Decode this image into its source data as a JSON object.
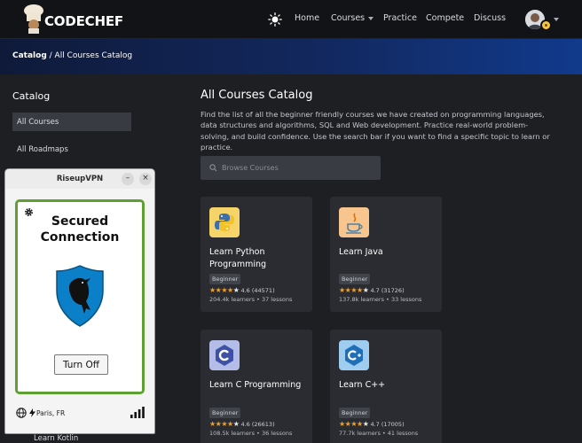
{
  "brand": {
    "name": "CODECHEF"
  },
  "nav": {
    "home": "Home",
    "courses": "Courses",
    "practice": "Practice",
    "compete": "Compete",
    "discuss": "Discuss"
  },
  "breadcrumb": {
    "root": "Catalog",
    "separator": " / ",
    "current": "All Courses Catalog"
  },
  "sidebar": {
    "heading": "Catalog",
    "items": [
      {
        "label": "All Courses",
        "active": true
      },
      {
        "label": "All Roadmaps",
        "active": false
      },
      {
        "label": "Learn Kotlin",
        "active": false
      }
    ]
  },
  "main": {
    "title": "All Courses Catalog",
    "description": "Find the list of all the beginner friendly courses we have created on programming languages, data structures and algorithms, SQL and Web development. Practice real-world problem-solving, and build confidence. Use the search bar if you want to find a specific topic to learn or practice.",
    "search_placeholder": "Browse Courses"
  },
  "courses": [
    {
      "title": "Learn Python Programming",
      "level": "Beginner",
      "rating": "4.6",
      "reviews": "(44571)",
      "stars": 4.6,
      "learners": "204.4k learners",
      "lessons": "37 lessons",
      "icon": "python-icon",
      "icon_bg": "#f5d46a"
    },
    {
      "title": "Learn Java",
      "level": "Beginner",
      "rating": "4.7",
      "reviews": "(31726)",
      "stars": 4.7,
      "learners": "137.8k learners",
      "lessons": "33 lessons",
      "icon": "java-icon",
      "icon_bg": "#f7c58d"
    },
    {
      "title": "Learn C Programming",
      "level": "Beginner",
      "rating": "4.6",
      "reviews": "(26613)",
      "stars": 4.6,
      "learners": "108.5k learners",
      "lessons": "36 lessons",
      "icon": "c-language-icon",
      "icon_bg": "#b3bde8"
    },
    {
      "title": "Learn C++",
      "level": "Beginner",
      "rating": "4.7",
      "reviews": "(17005)",
      "stars": 4.7,
      "learners": "77.7k learners",
      "lessons": "41 lessons",
      "icon": "cpp-language-icon",
      "icon_bg": "#9fcdf0"
    }
  ],
  "vpn": {
    "window_title": "RiseupVPN",
    "minimize": "–",
    "close": "×",
    "status": "Secured Connection",
    "toggle_label": "Turn Off",
    "location": "Paris, FR",
    "status_color": "#5ea032"
  },
  "colors": {
    "accent_star": "#f2a12c",
    "banner_start": "#0f1a3a",
    "banner_end": "#113a8c",
    "card_bg": "#2a2c31"
  }
}
